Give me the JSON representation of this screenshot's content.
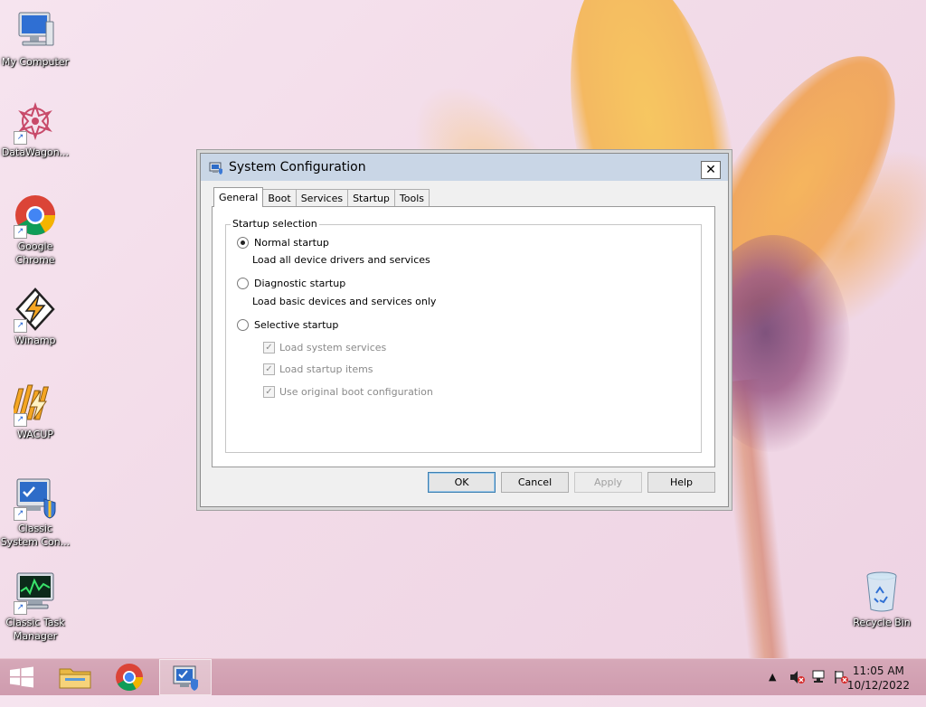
{
  "desktop": {
    "icons": [
      {
        "label": "My Computer",
        "icon": "computer-icon"
      },
      {
        "label": "DataWagon...",
        "icon": "datawagon-icon"
      },
      {
        "label": "Google Chrome",
        "icon": "chrome-icon"
      },
      {
        "label": "Winamp",
        "icon": "winamp-icon"
      },
      {
        "label": "WACUP",
        "icon": "wacup-icon"
      },
      {
        "label": "Classic System Con...",
        "icon": "system-config-icon"
      },
      {
        "label": "Classic Task Manager",
        "icon": "task-manager-icon"
      },
      {
        "label": "Recycle Bin",
        "icon": "recycle-bin-icon"
      }
    ]
  },
  "dialog": {
    "title": "System Configuration",
    "close_label": "✕",
    "tabs": [
      "General",
      "Boot",
      "Services",
      "Startup",
      "Tools"
    ],
    "active_tab": "General",
    "group_label": "Startup selection",
    "options": [
      {
        "label": "Normal startup",
        "desc": "Load all device drivers and services",
        "selected": true
      },
      {
        "label": "Diagnostic startup",
        "desc": "Load basic devices and services only",
        "selected": false
      },
      {
        "label": "Selective startup",
        "desc": "",
        "selected": false
      }
    ],
    "checkboxes": [
      {
        "label": "Load system services",
        "checked": true,
        "disabled": true
      },
      {
        "label": "Load startup items",
        "checked": true,
        "disabled": true
      },
      {
        "label": "Use original boot configuration",
        "checked": true,
        "disabled": true
      }
    ],
    "buttons": {
      "ok": "OK",
      "cancel": "Cancel",
      "apply": "Apply",
      "help": "Help"
    }
  },
  "taskbar": {
    "clock_time": "11:05 AM",
    "clock_date": "10/12/2022",
    "tray_arrow": "▲"
  },
  "colors": {
    "taskbar": "#cf9bae",
    "titlebar": "#c9d6e6",
    "accent": "#3c7fb1"
  }
}
